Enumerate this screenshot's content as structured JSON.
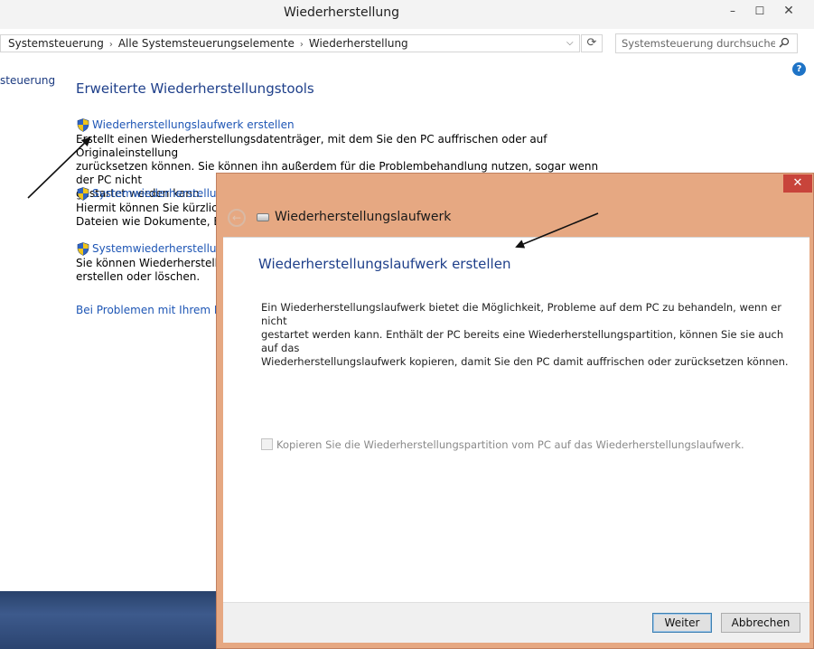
{
  "window": {
    "title": "Wiederherstellung",
    "minimize_glyph": "–",
    "maximize_glyph": "☐",
    "close_glyph": "✕"
  },
  "addressbar": {
    "crumbs": [
      "Systemsteuerung",
      "Alle Systemsteuerungselemente",
      "Wiederherstellung"
    ],
    "separator": "›",
    "dropdown_glyph": "⌵",
    "refresh_glyph": "⟳"
  },
  "search": {
    "placeholder": "Systemsteuerung durchsuchen",
    "icon": "search-icon"
  },
  "help": {
    "glyph": "?"
  },
  "left_nav": {
    "label": "steuerung"
  },
  "main": {
    "section_title": "Erweiterte Wiederherstellungstools",
    "tools": [
      {
        "link": "Wiederherstellungslaufwerk erstellen",
        "desc_lines": [
          "Erstellt einen Wiederherstellungsdatenträger, mit dem Sie den PC auffrischen oder auf Originaleinstellung",
          "zurücksetzen können. Sie können ihn außerdem für die Problembehandlung nutzen, sogar wenn der PC nicht",
          "gestartet werden kann."
        ]
      },
      {
        "link": "Systemwiederherstellung ö",
        "desc_lines": [
          "Hiermit können Sie kürzlich v",
          "Dateien wie Dokumente, Bilde"
        ]
      },
      {
        "link": "Systemwiederherstellung k",
        "desc_lines": [
          "Sie können Wiederherstellung",
          "erstellen oder löschen."
        ]
      }
    ],
    "bottom_link": "Bei Problemen mit Ihrem PC h"
  },
  "dialog": {
    "close_glyph": "✕",
    "back_glyph": "←",
    "caption": "Wiederherstellungslaufwerk",
    "heading": "Wiederherstellungslaufwerk erstellen",
    "body_lines": [
      "Ein Wiederherstellungslaufwerk bietet die Möglichkeit, Probleme auf dem PC zu behandeln, wenn er nicht",
      "gestartet werden kann. Enthält der PC bereits eine Wiederherstellungspartition, können Sie sie auch auf das",
      "Wiederherstellungslaufwerk kopieren, damit Sie den PC damit auffrischen oder zurücksetzen können."
    ],
    "checkbox_label": "Kopieren Sie die Wiederherstellungspartition vom PC auf das Wiederherstellungslaufwerk.",
    "checkbox_checked": false,
    "next_label": "Weiter",
    "cancel_label": "Abbrechen"
  },
  "colors": {
    "dialog_frame": "#e6a882",
    "link": "#1e56b5",
    "heading": "#1e3f8a",
    "close_red": "#c8443b"
  }
}
